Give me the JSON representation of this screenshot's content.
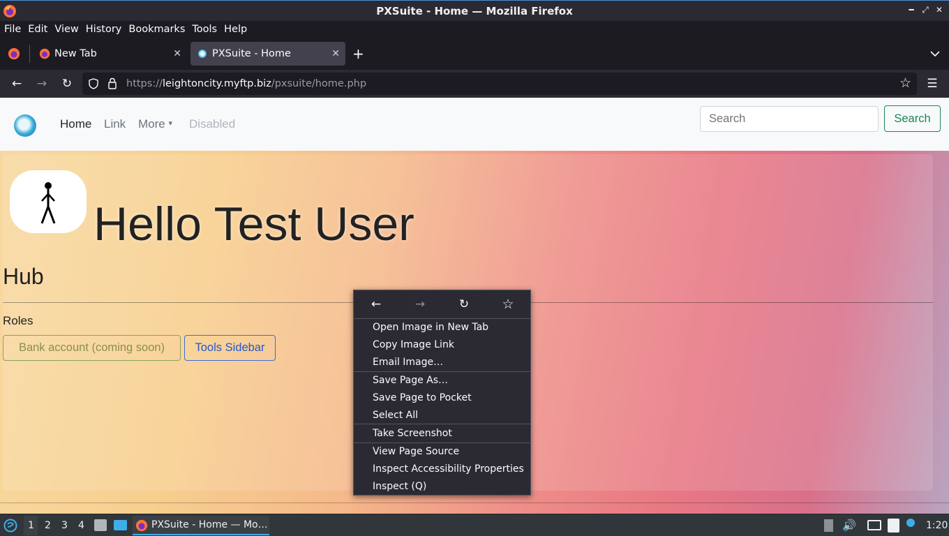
{
  "window": {
    "title": "PXSuite - Home — Mozilla Firefox"
  },
  "menubar": {
    "items": [
      {
        "label": "File"
      },
      {
        "label": "Edit"
      },
      {
        "label": "View"
      },
      {
        "label": "History"
      },
      {
        "label": "Bookmarks"
      },
      {
        "label": "Tools"
      },
      {
        "label": "Help"
      }
    ]
  },
  "tabs": [
    {
      "label": "New Tab",
      "active": false
    },
    {
      "label": "PXSuite - Home",
      "active": true
    }
  ],
  "urlbar": {
    "scheme": "https://",
    "host": "leightoncity.myftp.biz",
    "path": "/pxsuite/home.php"
  },
  "site_nav": {
    "links": [
      {
        "label": "Home",
        "state": "active"
      },
      {
        "label": "Link",
        "state": "normal"
      },
      {
        "label": "More",
        "state": "dropdown"
      },
      {
        "label": "Disabled",
        "state": "disabled"
      }
    ],
    "search_placeholder": "Search",
    "search_button": "Search"
  },
  "main": {
    "greeting": "Hello Test User",
    "section_title": "Hub",
    "roles_label": "Roles",
    "buttons": {
      "bank": "Bank account (coming soon)",
      "tools": "Tools Sidebar"
    }
  },
  "context_menu": {
    "groups": [
      [
        "Open Image in New Tab",
        "Copy Image Link",
        "Email Image…"
      ],
      [
        "Save Page As…",
        "Save Page to Pocket",
        "Select All"
      ],
      [
        "Take Screenshot"
      ],
      [
        "View Page Source",
        "Inspect Accessibility Properties",
        "Inspect (Q)"
      ]
    ]
  },
  "taskbar": {
    "workspaces": [
      "1",
      "2",
      "3",
      "4"
    ],
    "active_task": "PXSuite - Home — Mo…",
    "clock": "1:20"
  },
  "colors": {
    "accent_green": "#198754",
    "accent_blue": "#2358c9",
    "taskbar_highlight": "#3daee9"
  }
}
